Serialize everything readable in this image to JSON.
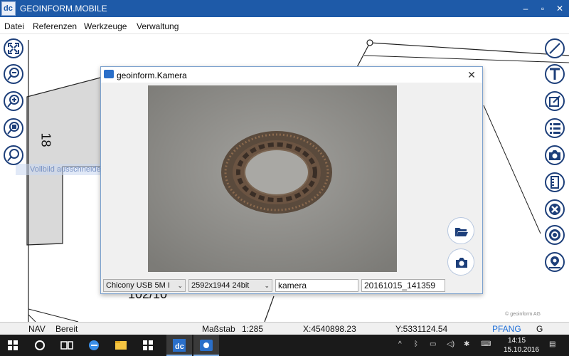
{
  "window": {
    "title": "GEOINFORM.MOBILE",
    "logo_text": "dc",
    "minimize": "–",
    "maximize": "▫",
    "close": "✕"
  },
  "menu": {
    "items": [
      "Datei",
      "Referenzen",
      "Werkzeuge",
      "Verwaltung"
    ]
  },
  "map": {
    "parcel_number": "18",
    "parcel_label_partial": "102/10",
    "ghost_tooltip": "Vollbild ausschneiden",
    "copyright": "© geoinform AG"
  },
  "left_toolbar": [
    "zoom-extent-icon",
    "zoom-out-icon",
    "zoom-in-icon",
    "zoom-window-icon",
    "zoom-search-icon"
  ],
  "right_toolbar": [
    "line-icon",
    "text-icon",
    "edit-icon",
    "list-icon",
    "camera-icon",
    "ruler-icon",
    "delete-icon",
    "target-icon",
    "location-icon"
  ],
  "dialog": {
    "title": "geoinform.Kamera",
    "close": "✕",
    "device_select": "Chicony USB 5M I",
    "resolution_select": "2592x1944 24bit",
    "name_field": "kamera",
    "timestamp_field": "20161015_141359",
    "open_folder_icon": "folder-open-icon",
    "capture_icon": "camera-icon"
  },
  "status": {
    "mode": "NAV",
    "state": "Bereit",
    "scale_label": "Maßstab",
    "scale_value": "1:285",
    "x": "X:4540898.23",
    "y": "Y:5331124.54",
    "snap": "PFANG",
    "extra": "G"
  },
  "taskbar": {
    "time": "14:15",
    "date": "15.10.2016",
    "apps": [
      "windows-start-icon",
      "cortana-icon",
      "task-view-icon",
      "edge-icon",
      "file-explorer-icon",
      "store-icon",
      "geoinform-app-icon",
      "camera-app-icon"
    ]
  },
  "colors": {
    "titlebar": "#1e5aa8",
    "tool_border": "#1d3f7a",
    "snap_text": "#1e6fd9"
  }
}
